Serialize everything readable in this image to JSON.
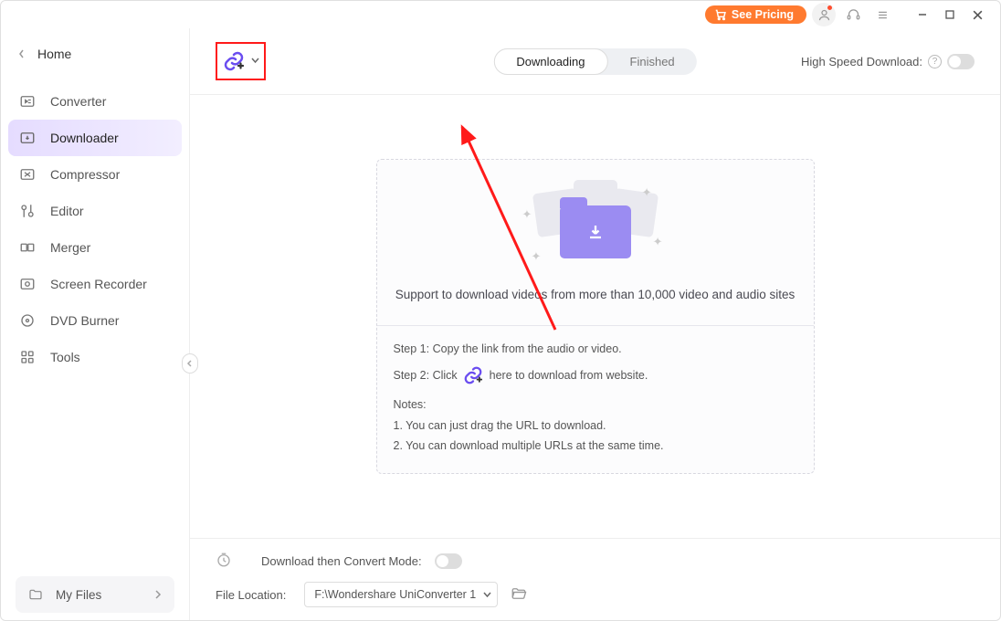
{
  "titlebar": {
    "pricing_label": "See Pricing"
  },
  "sidebar": {
    "home_label": "Home",
    "items": [
      {
        "label": "Converter"
      },
      {
        "label": "Downloader"
      },
      {
        "label": "Compressor"
      },
      {
        "label": "Editor"
      },
      {
        "label": "Merger"
      },
      {
        "label": "Screen Recorder"
      },
      {
        "label": "DVD Burner"
      },
      {
        "label": "Tools"
      }
    ],
    "myfiles_label": "My Files"
  },
  "toolbar": {
    "tabs": {
      "downloading": "Downloading",
      "finished": "Finished"
    },
    "hsd_label": "High Speed Download:"
  },
  "panel": {
    "headline": "Support to download videos from more than 10,000 video and audio sites",
    "step1": "Step 1: Copy the link from the audio or video.",
    "step2_a": "Step 2: Click",
    "step2_b": "here to download from website.",
    "notes_label": "Notes:",
    "note1": "1. You can just drag the URL to download.",
    "note2": "2. You can download multiple URLs at the same time."
  },
  "bottom": {
    "convert_mode_label": "Download then Convert Mode:",
    "file_location_label": "File Location:",
    "file_location_value": "F:\\Wondershare UniConverter 1"
  }
}
